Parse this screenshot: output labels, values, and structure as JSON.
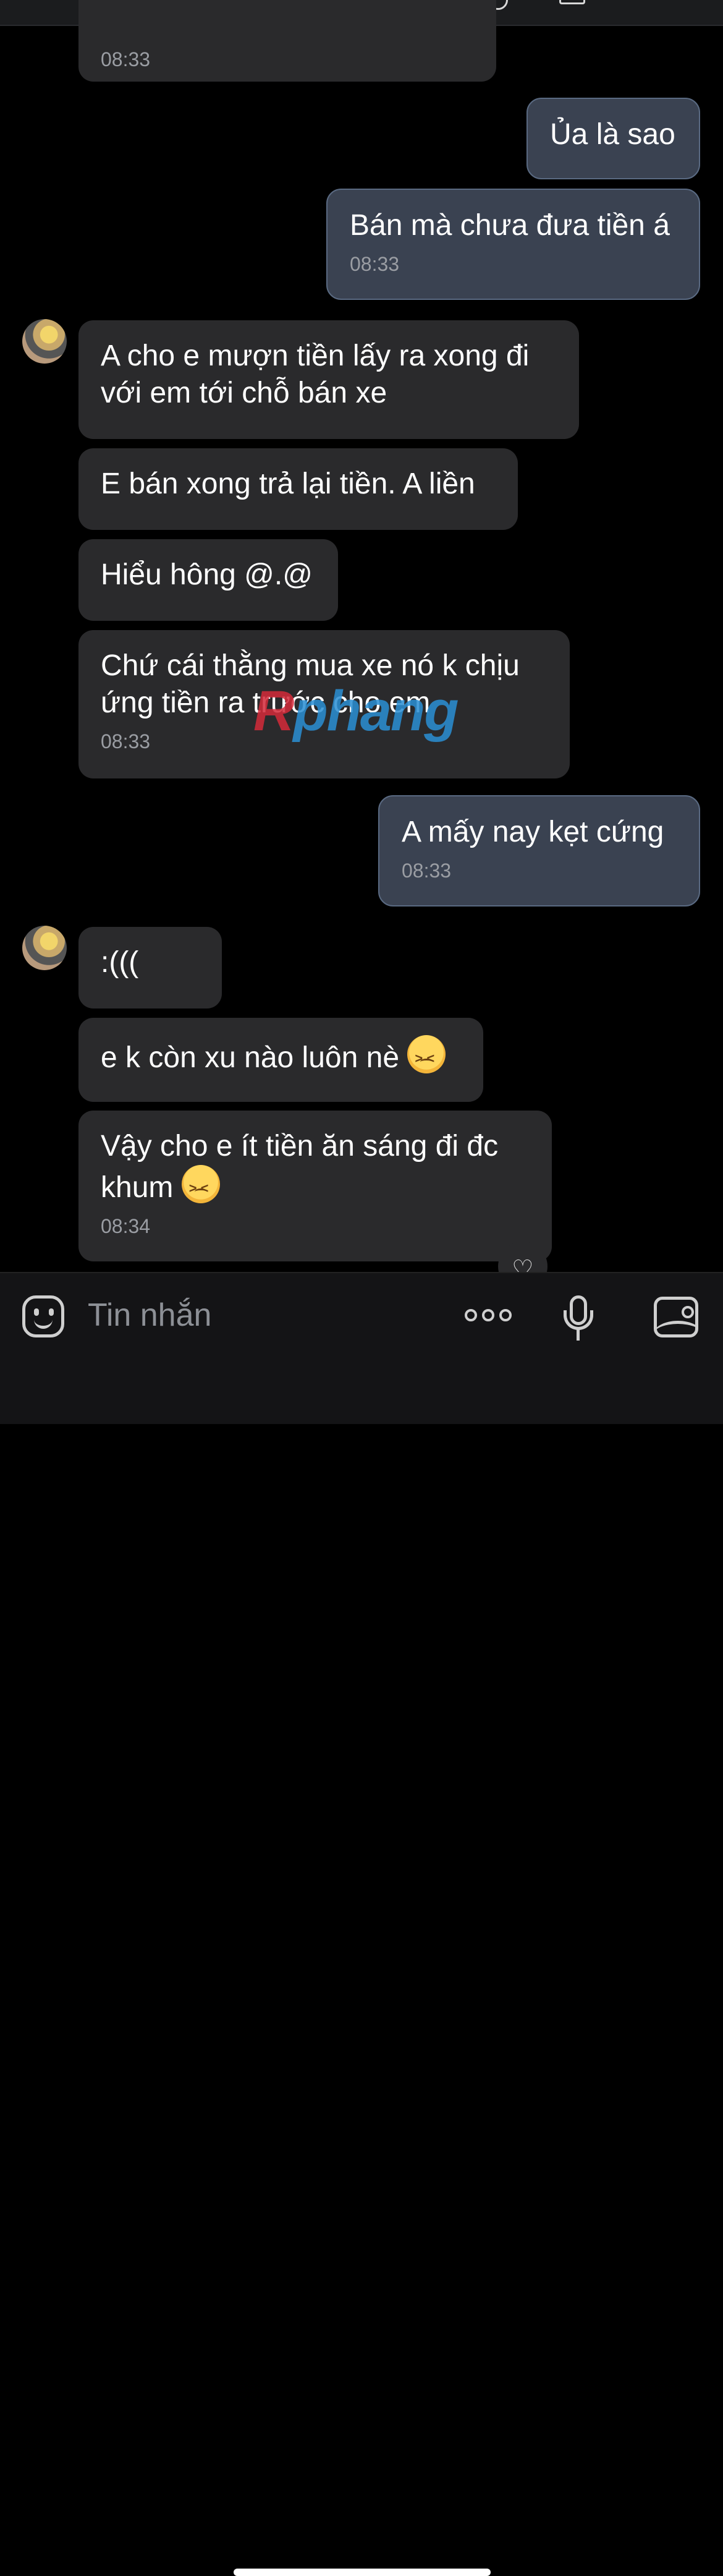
{
  "header": {
    "title_fragment": "y"
  },
  "messages": [
    {
      "from": "them",
      "time": "08:33"
    },
    {
      "from": "me",
      "text": "Ủa là sao"
    },
    {
      "from": "me",
      "text": "Bán mà chưa đưa tiền á",
      "time": "08:33"
    },
    {
      "from": "them",
      "text": "A cho e mượn tiền lấy ra xong đi với em tới chỗ bán xe"
    },
    {
      "from": "them",
      "text": "E bán xong trả lại tiền. A liền"
    },
    {
      "from": "them",
      "text": "Hiểu hông @.@"
    },
    {
      "from": "them",
      "text": "Chứ cái thằng mua xe nó k chịu ứng tiền ra trước cho em",
      "time": "08:33"
    },
    {
      "from": "me",
      "text": "A mấy nay kẹt cứng",
      "time": "08:33"
    },
    {
      "from": "them",
      "text": ":((("
    },
    {
      "from": "them",
      "text": "e k còn xu nào luôn nè",
      "emoji": "persevering-face"
    },
    {
      "from": "them",
      "text": "Vậy cho e ít tiền ăn sáng đi đc khum",
      "emoji": "persevering-face",
      "time": "08:34"
    }
  ],
  "watermark": {
    "part1": "R",
    "part2": "phang"
  },
  "input": {
    "placeholder": "Tin nhắn"
  },
  "icons": {
    "emoji_picker": "smile-icon",
    "more": "more-dots-icon",
    "voice": "microphone-icon",
    "photo": "photo-icon",
    "reaction": "heart-icon"
  },
  "colors": {
    "incoming_bubble": "#2a2a2c",
    "outgoing_bubble": "#3a4251",
    "background": "#000000"
  }
}
